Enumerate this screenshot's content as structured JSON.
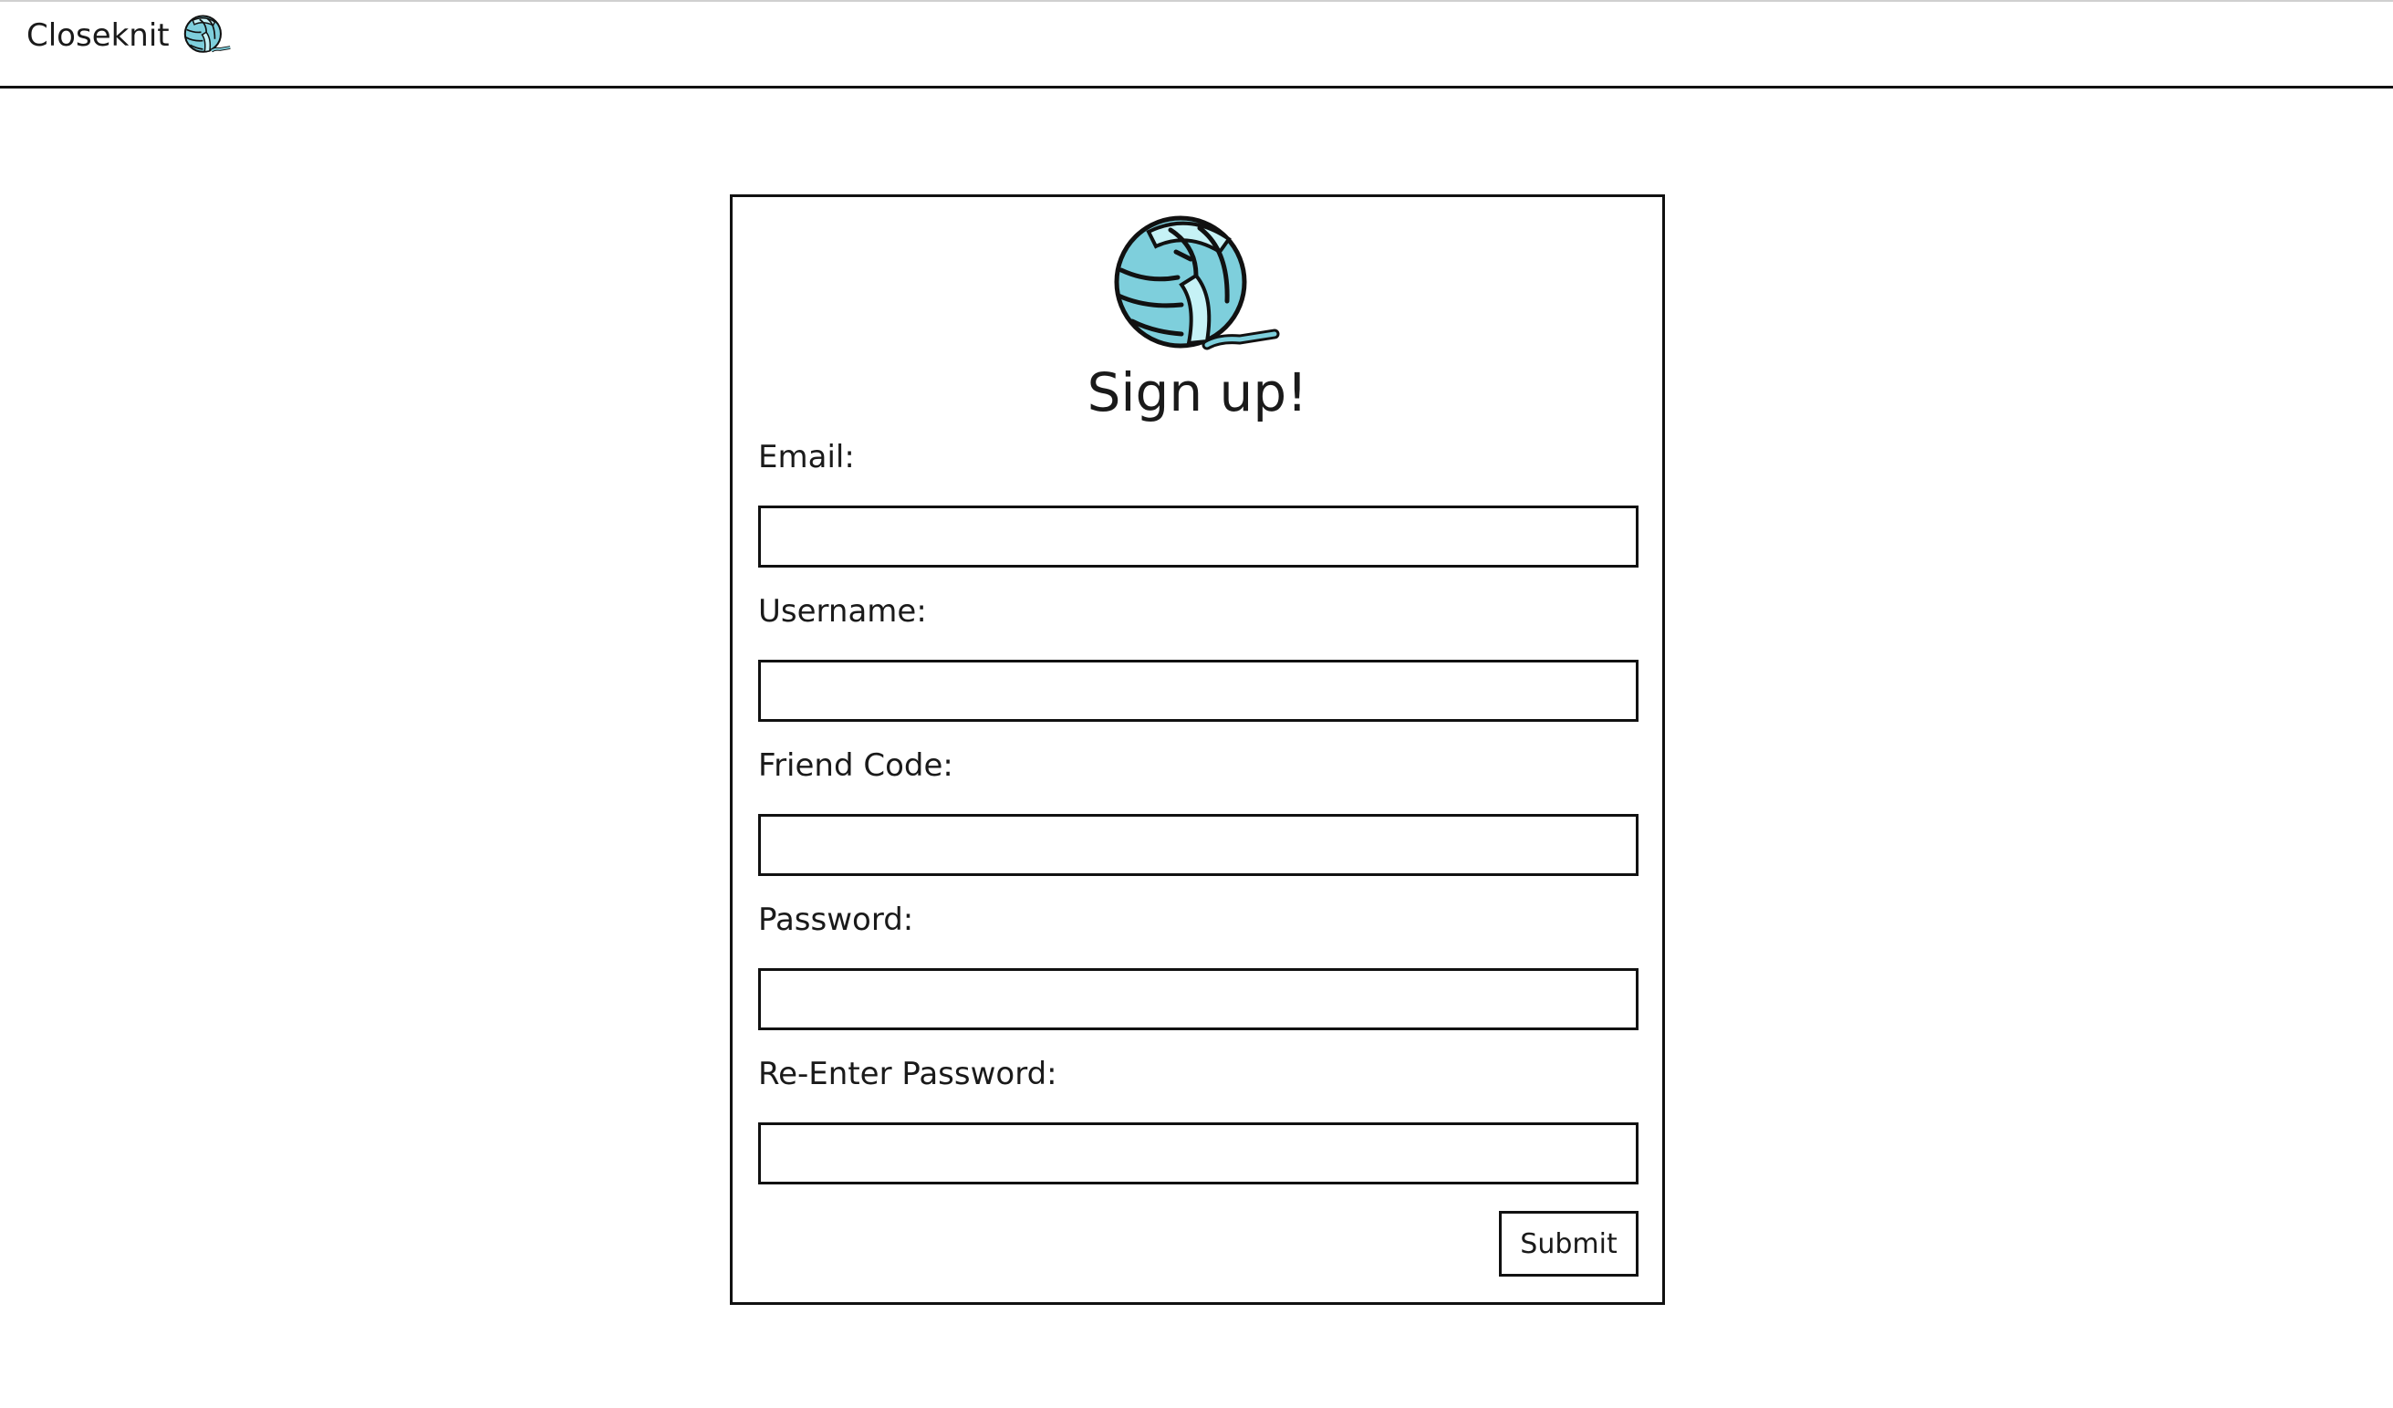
{
  "brand": {
    "name": "Closeknit",
    "icon": "yarn-ball-icon"
  },
  "colors": {
    "yarn_main": "#7ecfdc",
    "yarn_light": "#c6f2f6",
    "border": "#111111",
    "text": "#1a1a1a"
  },
  "signup": {
    "logo_icon": "yarn-ball-icon",
    "title": "Sign up!",
    "fields": [
      {
        "label": "Email:",
        "value": ""
      },
      {
        "label": "Username:",
        "value": ""
      },
      {
        "label": "Friend Code:",
        "value": ""
      },
      {
        "label": "Password:",
        "value": ""
      },
      {
        "label": "Re-Enter Password:",
        "value": ""
      }
    ],
    "submit_label": "Submit"
  }
}
